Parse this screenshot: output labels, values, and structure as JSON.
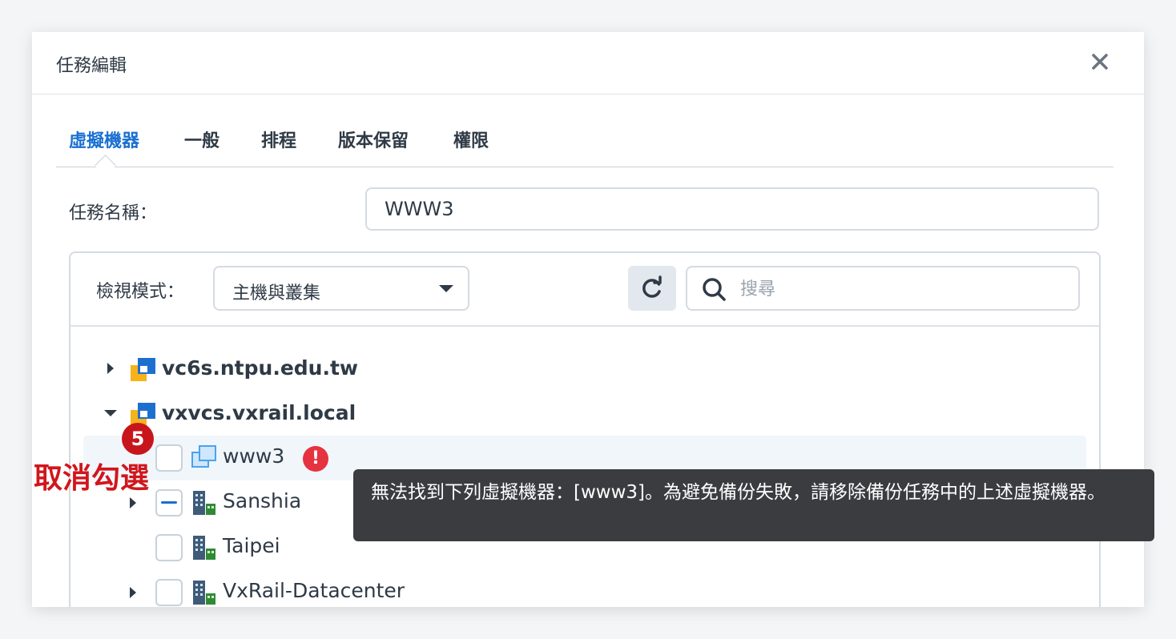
{
  "dialog": {
    "title": "任務編輯",
    "close_icon": "close-icon"
  },
  "tabs": [
    {
      "label": "虛擬機器",
      "active": true
    },
    {
      "label": "一般",
      "active": false
    },
    {
      "label": "排程",
      "active": false
    },
    {
      "label": "版本保留",
      "active": false
    },
    {
      "label": "權限",
      "active": false
    }
  ],
  "task_name": {
    "label": "任務名稱：",
    "value": "WWW3"
  },
  "toolbar": {
    "view_mode_label": "檢視模式：",
    "view_mode_value": "主機與叢集",
    "refresh_icon": "refresh-icon",
    "search_icon": "search-icon",
    "search_placeholder": "搜尋"
  },
  "tree": {
    "vcenter1": {
      "label": "vc6s.ntpu.edu.tw",
      "expanded": false,
      "icon": "vcenter-icon"
    },
    "vcenter2": {
      "label": "vxvcs.vxrail.local",
      "expanded": true,
      "icon": "vcenter-icon"
    },
    "vm_www3": {
      "label": "www3",
      "checked": false,
      "icon": "vm-icon",
      "warning_icon": "error-icon",
      "warning_mark": "!"
    },
    "cluster_sanshia": {
      "label": "Sanshia",
      "state": "partial",
      "icon": "building-icon"
    },
    "cluster_taipei": {
      "label": "Taipei",
      "state": "unchecked",
      "icon": "building-icon"
    },
    "cluster_vxrail": {
      "label": "VxRail-Datacenter",
      "state": "unchecked",
      "icon": "building-icon"
    }
  },
  "tooltip": {
    "text": "無法找到下列虛擬機器：[www3]。為避免備份失敗，請移除備份任務中的上述虛擬機器。"
  },
  "annotation": {
    "step": "5",
    "text": "取消勾選"
  },
  "colors": {
    "accent": "#1a6fd1",
    "error": "#e5333f",
    "annotation": "#d0161c",
    "tooltip_bg": "#3a3c3f"
  }
}
